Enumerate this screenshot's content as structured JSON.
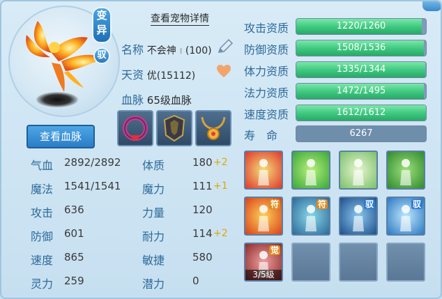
{
  "badges": {
    "variant": "变异",
    "yu": "驭"
  },
  "view_detail": "查看宠物详情",
  "name_label": "名称",
  "name_value": "不会神",
  "name_level": "(100)",
  "talent_label": "天资",
  "talent_value": "优(15112)",
  "bloodline_label": "血脉",
  "bloodline_value": "65级血脉",
  "bloodline_button": "查看血脉",
  "aptitudes": [
    {
      "label": "攻击资质",
      "value": "1220/1260",
      "ratio": 0.968
    },
    {
      "label": "防御资质",
      "value": "1508/1536",
      "ratio": 0.982
    },
    {
      "label": "体力资质",
      "value": "1335/1344",
      "ratio": 0.993
    },
    {
      "label": "法力资质",
      "value": "1472/1495",
      "ratio": 0.985
    },
    {
      "label": "速度资质",
      "value": "1612/1612",
      "ratio": 1.0
    }
  ],
  "life": {
    "label": "寿　命",
    "value": "6267"
  },
  "stats_left": [
    {
      "label": "气血",
      "value": "2892/2892"
    },
    {
      "label": "魔法",
      "value": "1541/1541"
    },
    {
      "label": "攻击",
      "value": "636"
    },
    {
      "label": "防御",
      "value": "601"
    },
    {
      "label": "速度",
      "value": "865"
    },
    {
      "label": "灵力",
      "value": "259"
    }
  ],
  "stats_right": [
    {
      "label": "体质",
      "value": "180",
      "plus": "+2"
    },
    {
      "label": "魔力",
      "value": "111",
      "plus": "+1"
    },
    {
      "label": "力量",
      "value": "120",
      "plus": ""
    },
    {
      "label": "耐力",
      "value": "114",
      "plus": "+2"
    },
    {
      "label": "敏捷",
      "value": "580",
      "plus": ""
    },
    {
      "label": "潜力",
      "value": "0",
      "plus": ""
    }
  ],
  "skills": [
    {
      "tag": "",
      "icon": "figure-red-aura-icon",
      "colors": [
        "#f3e07a",
        "#e0372c"
      ]
    },
    {
      "tag": "",
      "icon": "figure-green-burst-icon",
      "colors": [
        "#b8f07a",
        "#3aa83a"
      ]
    },
    {
      "tag": "",
      "icon": "lightning-palm-icon",
      "colors": [
        "#e8f5d0",
        "#7ac06a"
      ]
    },
    {
      "tag": "",
      "icon": "green-giant-icon",
      "colors": [
        "#9fe07a",
        "#2f8a2f"
      ]
    },
    {
      "tag": "符",
      "icon": "fire-fist-icon",
      "colors": [
        "#ffd25a",
        "#d8421a"
      ]
    },
    {
      "tag": "符",
      "icon": "spirit-body-icon",
      "colors": [
        "#8ad8e8",
        "#2d6a9a"
      ]
    },
    {
      "tag": "驭",
      "icon": "crystal-beast-icon",
      "colors": [
        "#8ac8f0",
        "#1f4f8a"
      ]
    },
    {
      "tag": "驭",
      "icon": "sword-shield-icon",
      "colors": [
        "#bfe8ff",
        "#2d79c0"
      ]
    },
    {
      "tag": "觉",
      "icon": "awaken-spirit-icon",
      "colors": [
        "#f0a0a0",
        "#8a2a2a"
      ],
      "level": "3/5级"
    }
  ],
  "colors": {
    "accent": "#2e6a9a",
    "bar_fill": "#3cc77e",
    "plus": "#e0a800"
  }
}
